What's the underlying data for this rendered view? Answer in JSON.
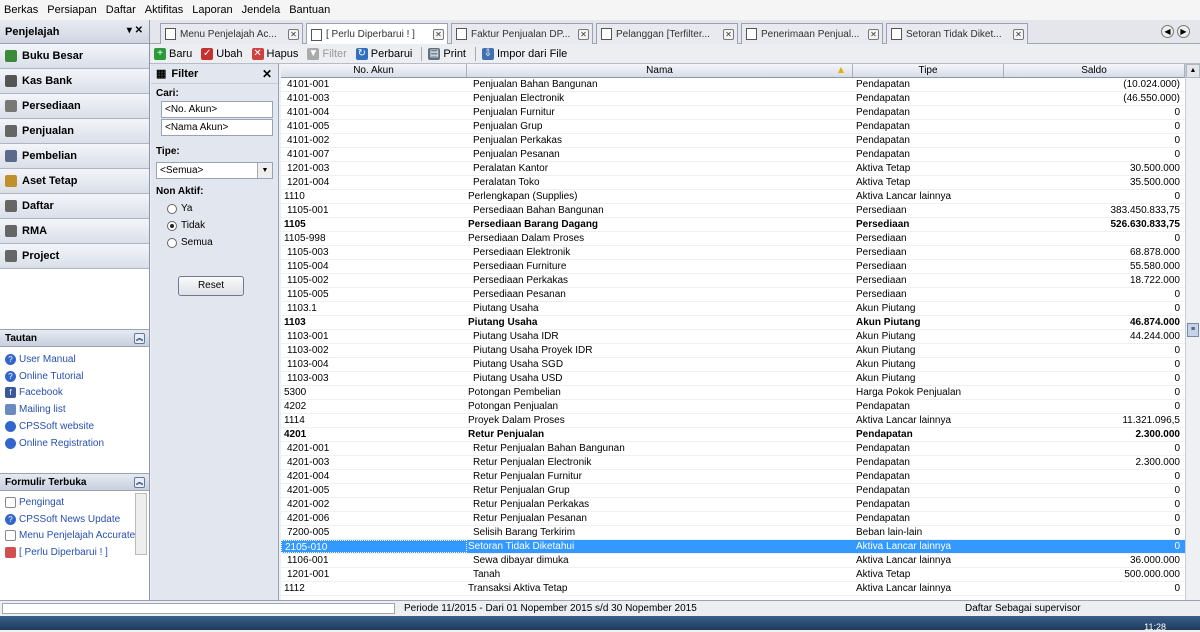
{
  "menu": [
    "Berkas",
    "Persiapan",
    "Daftar",
    "Aktifitas",
    "Laporan",
    "Jendela",
    "Bantuan"
  ],
  "tabs": [
    {
      "label": "Menu Penjelajah Ac..."
    },
    {
      "label": "[ Perlu Diperbarui ! ]"
    },
    {
      "label": "Faktur Penjualan DP..."
    },
    {
      "label": "Pelanggan [Terfilter..."
    },
    {
      "label": "Penerimaan Penjual..."
    },
    {
      "label": "Setoran Tidak Diket..."
    }
  ],
  "toolbar": {
    "baru": "Baru",
    "ubah": "Ubah",
    "hapus": "Hapus",
    "filter": "Filter",
    "perbarui": "Perbarui",
    "print": "Print",
    "impor": "Impor dari File"
  },
  "sidebar": {
    "title": "Penjelajah",
    "nav": [
      "Buku Besar",
      "Kas Bank",
      "Persediaan",
      "Penjualan",
      "Pembelian",
      "Aset Tetap",
      "Daftar",
      "RMA",
      "Project"
    ],
    "tautan_title": "Tautan",
    "tautan": [
      "User Manual",
      "Online Tutorial",
      "Facebook",
      "Mailing list",
      "CPSSoft website",
      "Online Registration"
    ],
    "formulir_title": "Formulir Terbuka",
    "formulir": [
      "Pengingat",
      "CPSSoft News Update",
      "Menu Penjelajah Accurate",
      "[ Perlu Diperbarui ! ]"
    ]
  },
  "filter": {
    "title": "Filter",
    "cari_label": "Cari:",
    "no_akun_placeholder": "<No. Akun>",
    "nama_akun_placeholder": "<Nama Akun>",
    "tipe_label": "Tipe:",
    "tipe_value": "<Semua>",
    "non_aktif_label": "Non Aktif:",
    "options": [
      "Ya",
      "Tidak",
      "Semua"
    ],
    "selected": "Tidak",
    "reset": "Reset"
  },
  "table": {
    "headers": [
      "No. Akun",
      "Nama",
      "Tipe",
      "Saldo"
    ],
    "rows": [
      {
        "no": "4101-001",
        "nama": "Penjualan Bahan Bangunan",
        "tipe": "Pendapatan",
        "saldo": "(10.024.000)",
        "lvl": 1
      },
      {
        "no": "4101-003",
        "nama": "Penjualan Electronik",
        "tipe": "Pendapatan",
        "saldo": "(46.550.000)",
        "lvl": 1
      },
      {
        "no": "4101-004",
        "nama": "Penjualan Furnitur",
        "tipe": "Pendapatan",
        "saldo": "0",
        "lvl": 1
      },
      {
        "no": "4101-005",
        "nama": "Penjualan Grup",
        "tipe": "Pendapatan",
        "saldo": "0",
        "lvl": 1
      },
      {
        "no": "4101-002",
        "nama": "Penjualan Perkakas",
        "tipe": "Pendapatan",
        "saldo": "0",
        "lvl": 1
      },
      {
        "no": "4101-007",
        "nama": "Penjualan Pesanan",
        "tipe": "Pendapatan",
        "saldo": "0",
        "lvl": 1
      },
      {
        "no": "1201-003",
        "nama": "Peralatan Kantor",
        "tipe": "Aktiva Tetap",
        "saldo": "30.500.000",
        "lvl": 1
      },
      {
        "no": "1201-004",
        "nama": "Peralatan Toko",
        "tipe": "Aktiva Tetap",
        "saldo": "35.500.000",
        "lvl": 1
      },
      {
        "no": "1110",
        "nama": "Perlengkapan (Supplies)",
        "tipe": "Aktiva Lancar lainnya",
        "saldo": "0",
        "lvl": 0
      },
      {
        "no": "1105-001",
        "nama": "Persediaan Bahan Bangunan",
        "tipe": "Persediaan",
        "saldo": "383.450.833,75",
        "lvl": 1
      },
      {
        "no": "1105",
        "nama": "Persediaan Barang Dagang",
        "tipe": "Persediaan",
        "saldo": "526.630.833,75",
        "lvl": 0,
        "bold": true
      },
      {
        "no": "1105-998",
        "nama": "Persediaan Dalam Proses",
        "tipe": "Persediaan",
        "saldo": "0",
        "lvl": 0
      },
      {
        "no": "1105-003",
        "nama": "Persediaan Elektronik",
        "tipe": "Persediaan",
        "saldo": "68.878.000",
        "lvl": 1
      },
      {
        "no": "1105-004",
        "nama": "Persediaan Furniture",
        "tipe": "Persediaan",
        "saldo": "55.580.000",
        "lvl": 1
      },
      {
        "no": "1105-002",
        "nama": "Persediaan Perkakas",
        "tipe": "Persediaan",
        "saldo": "18.722.000",
        "lvl": 1
      },
      {
        "no": "1105-005",
        "nama": "Persediaan Pesanan",
        "tipe": "Persediaan",
        "saldo": "0",
        "lvl": 1
      },
      {
        "no": "1103.1",
        "nama": "Piutang Usaha",
        "tipe": "Akun Piutang",
        "saldo": "0",
        "lvl": 1
      },
      {
        "no": "1103",
        "nama": "Piutang Usaha",
        "tipe": "Akun Piutang",
        "saldo": "46.874.000",
        "lvl": 0,
        "bold": true
      },
      {
        "no": "1103-001",
        "nama": "Piutang Usaha IDR",
        "tipe": "Akun Piutang",
        "saldo": "44.244.000",
        "lvl": 1
      },
      {
        "no": "1103-002",
        "nama": "Piutang Usaha Proyek IDR",
        "tipe": "Akun Piutang",
        "saldo": "0",
        "lvl": 1
      },
      {
        "no": "1103-004",
        "nama": "Piutang Usaha SGD",
        "tipe": "Akun Piutang",
        "saldo": "0",
        "lvl": 1
      },
      {
        "no": "1103-003",
        "nama": "Piutang Usaha USD",
        "tipe": "Akun Piutang",
        "saldo": "0",
        "lvl": 1
      },
      {
        "no": "5300",
        "nama": "Potongan Pembelian",
        "tipe": "Harga Pokok Penjualan",
        "saldo": "0",
        "lvl": 0
      },
      {
        "no": "4202",
        "nama": "Potongan Penjualan",
        "tipe": "Pendapatan",
        "saldo": "0",
        "lvl": 0
      },
      {
        "no": "1114",
        "nama": "Proyek Dalam Proses",
        "tipe": "Aktiva Lancar lainnya",
        "saldo": "11.321.096,5",
        "lvl": 0
      },
      {
        "no": "4201",
        "nama": "Retur Penjualan",
        "tipe": "Pendapatan",
        "saldo": "2.300.000",
        "lvl": 0,
        "bold": true
      },
      {
        "no": "4201-001",
        "nama": "Retur Penjualan Bahan Bangunan",
        "tipe": "Pendapatan",
        "saldo": "0",
        "lvl": 1
      },
      {
        "no": "4201-003",
        "nama": "Retur Penjualan Electronik",
        "tipe": "Pendapatan",
        "saldo": "2.300.000",
        "lvl": 1
      },
      {
        "no": "4201-004",
        "nama": "Retur Penjualan Furnitur",
        "tipe": "Pendapatan",
        "saldo": "0",
        "lvl": 1
      },
      {
        "no": "4201-005",
        "nama": "Retur Penjualan Grup",
        "tipe": "Pendapatan",
        "saldo": "0",
        "lvl": 1
      },
      {
        "no": "4201-002",
        "nama": "Retur Penjualan Perkakas",
        "tipe": "Pendapatan",
        "saldo": "0",
        "lvl": 1
      },
      {
        "no": "4201-006",
        "nama": "Retur Penjualan Pesanan",
        "tipe": "Pendapatan",
        "saldo": "0",
        "lvl": 1
      },
      {
        "no": "7200-005",
        "nama": "Selisih Barang Terkirim",
        "tipe": "Beban lain-lain",
        "saldo": "0",
        "lvl": 1
      },
      {
        "no": "2105-010",
        "nama": "Setoran Tidak Diketahui",
        "tipe": "Aktiva Lancar lainnya",
        "saldo": "0",
        "lvl": 0,
        "selected": true
      },
      {
        "no": "1106-001",
        "nama": "Sewa dibayar dimuka",
        "tipe": "Aktiva Lancar lainnya",
        "saldo": "36.000.000",
        "lvl": 1
      },
      {
        "no": "1201-001",
        "nama": "Tanah",
        "tipe": "Aktiva Tetap",
        "saldo": "500.000.000",
        "lvl": 1
      },
      {
        "no": "1112",
        "nama": "Transaksi Aktiva Tetap",
        "tipe": "Aktiva Lancar lainnya",
        "saldo": "0",
        "lvl": 0
      }
    ]
  },
  "status": {
    "periode": "Periode 11/2015 - Dari 01 Nopember 2015 s/d 30 Nopember 2015",
    "user": "Daftar Sebagai supervisor"
  },
  "clock": "11:28"
}
